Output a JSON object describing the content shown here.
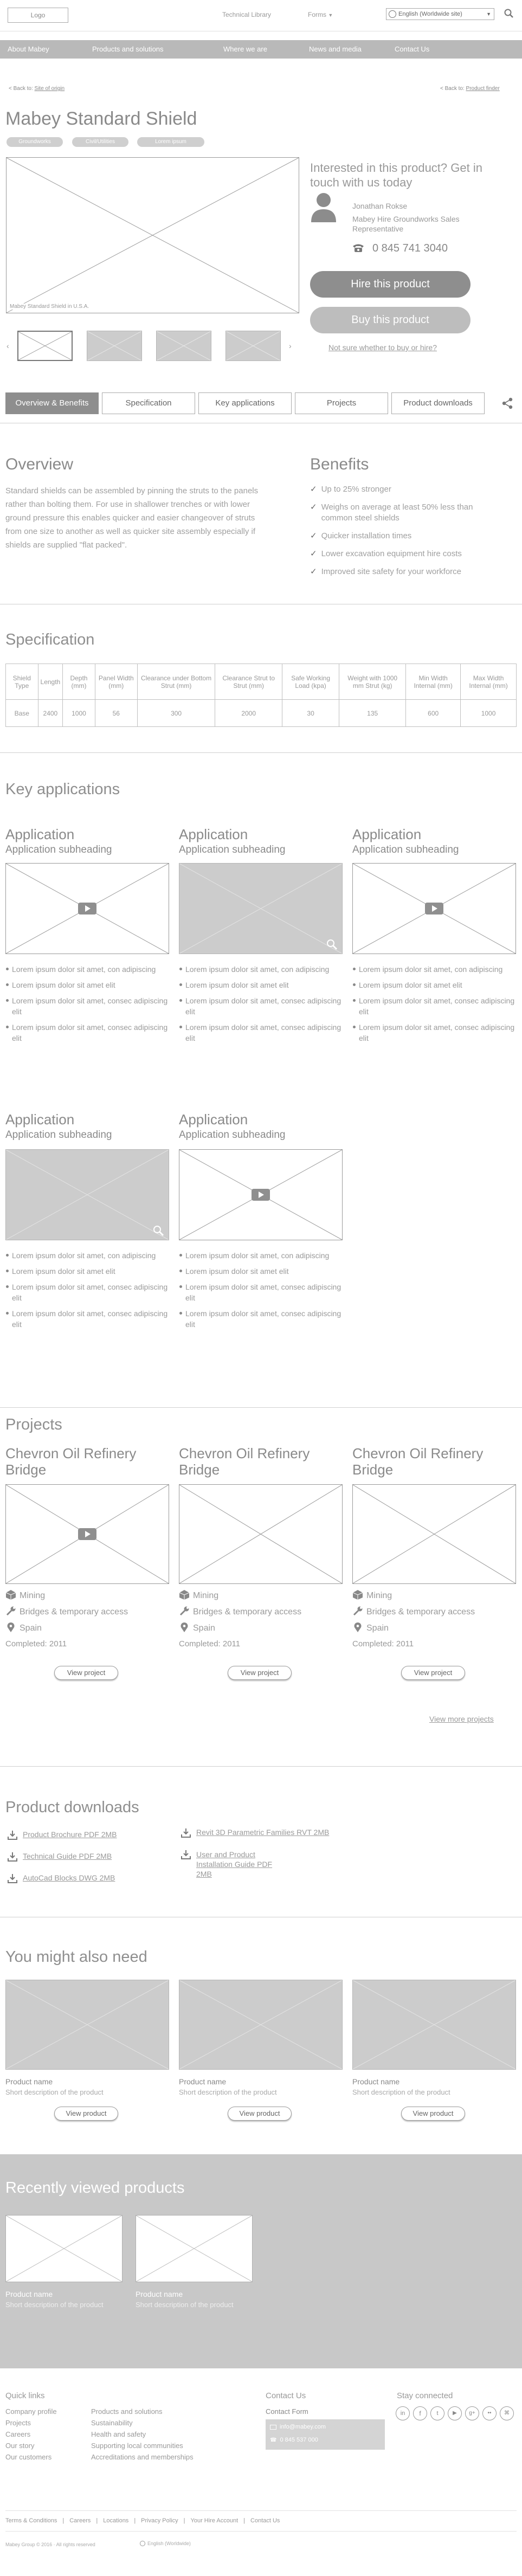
{
  "header": {
    "logo": "Logo",
    "links": [
      "Technical Library",
      "Forms"
    ],
    "language": "English (Worldwide site)",
    "nav": [
      "About Mabey",
      "Products and solutions",
      "Where we are",
      "News and media",
      "Contact Us"
    ]
  },
  "breadcrumbs": {
    "back": "< Back to:",
    "back_link": "Site of origin",
    "back_right": "< Back to:",
    "back_right_link": "Product finder"
  },
  "product": {
    "title": "Mabey Standard Shield",
    "tags": [
      "Groundworks",
      "Civil/Utilities",
      "Lorem ipsum"
    ],
    "image_caption": "Mabey Standard Shield in U.S.A."
  },
  "contact_box": {
    "heading": "Interested in this product? Get in touch with us today",
    "name": "Jonathan Rokse",
    "role": "Mabey Hire Groundworks Sales Representative",
    "phone": "0 845 741 3040",
    "hire_button": "Hire this product",
    "buy_button": "Buy this product",
    "unsure_link": "Not sure whether to buy or hire?"
  },
  "tabs": [
    "Overview & Benefits",
    "Specification",
    "Key applications",
    "Projects",
    "Product downloads"
  ],
  "overview": {
    "heading": "Overview",
    "text": "Standard shields can be assembled by pinning the struts to the panels rather than bolting them. For use in shallower trenches or with lower ground pressure this enables quicker and easier changeover of struts from one size to another as well as quicker site assembly especially if shields are supplied \"flat packed\"."
  },
  "benefits": {
    "heading": "Benefits",
    "items": [
      "Up to 25% stronger",
      "Weighs on average at least 50% less than common steel shields",
      "Quicker installation times",
      "Lower excavation equipment hire costs",
      "Improved site safety for your workforce"
    ]
  },
  "specification": {
    "heading": "Specification",
    "headers": [
      "Shield Type",
      "Length",
      "Depth (mm)",
      "Panel Width (mm)",
      "Clearance under Bottom Strut (mm)",
      "Clearance Strut to Strut (mm)",
      "Safe Working Load (kpa)",
      "Weight with 1000 mm Strut (kg)",
      "Min Width Internal (mm)",
      "Max Width Internal (mm)"
    ],
    "row": [
      "Base",
      "2400",
      "1000",
      "56",
      "300",
      "2000",
      "30",
      "135",
      "600",
      "1000"
    ]
  },
  "key_applications": {
    "heading": "Key applications",
    "items": [
      {
        "title": "Application",
        "subheading": "Application subheading",
        "bullets": [
          "Lorem ipsum dolor sit amet, con adipiscing",
          "Lorem ipsum dolor sit amet elit",
          "Lorem ipsum dolor sit amet, consec adipiscing elit",
          "Lorem ipsum dolor sit amet, consec adipiscing elit"
        ]
      },
      {
        "title": "Application",
        "subheading": "Application subheading",
        "bullets": [
          "Lorem ipsum dolor sit amet, con adipiscing",
          "Lorem ipsum dolor sit amet elit",
          "Lorem ipsum dolor sit amet, consec adipiscing elit",
          "Lorem ipsum dolor sit amet, consec adipiscing elit"
        ]
      },
      {
        "title": "Application",
        "subheading": "Application subheading",
        "bullets": [
          "Lorem ipsum dolor sit amet, con adipiscing",
          "Lorem ipsum dolor sit amet elit",
          "Lorem ipsum dolor sit amet, consec adipiscing elit",
          "Lorem ipsum dolor sit amet, consec adipiscing elit"
        ]
      },
      {
        "title": "Application",
        "subheading": "Application subheading",
        "bullets": [
          "Lorem ipsum dolor sit amet, con adipiscing",
          "Lorem ipsum dolor sit amet elit",
          "Lorem ipsum dolor sit amet, consec adipiscing elit",
          "Lorem ipsum dolor sit amet, consec adipiscing elit"
        ]
      },
      {
        "title": "Application",
        "subheading": "Application subheading",
        "bullets": [
          "Lorem ipsum dolor sit amet, con adipiscing",
          "Lorem ipsum dolor sit amet elit",
          "Lorem ipsum dolor sit amet, consec adipiscing elit",
          "Lorem ipsum dolor sit amet, consec adipiscing elit"
        ]
      }
    ]
  },
  "projects": {
    "heading": "Projects",
    "items": [
      {
        "title": "Chevron Oil Refinery Bridge",
        "sector": "Mining",
        "type": "Bridges & temporary access",
        "country": "Spain",
        "completed": "Completed: 2011",
        "button": "View project"
      },
      {
        "title": "Chevron Oil Refinery Bridge",
        "sector": "Mining",
        "type": "Bridges & temporary access",
        "country": "Spain",
        "completed": "Completed: 2011",
        "button": "View project"
      },
      {
        "title": "Chevron Oil Refinery Bridge",
        "sector": "Mining",
        "type": "Bridges & temporary access",
        "country": "Spain",
        "completed": "Completed: 2011",
        "button": "View project"
      }
    ],
    "more_link": "View more projects"
  },
  "downloads": {
    "heading": "Product downloads",
    "left": [
      "Product Brochure PDF 2MB",
      "Technical Guide PDF 2MB",
      "AutoCad Blocks DWG 2MB"
    ],
    "right": [
      "Revit 3D Parametric Families RVT 2MB",
      "User and Product Installation Guide PDF 2MB"
    ]
  },
  "also_need": {
    "heading": "You might also need",
    "items": [
      {
        "name": "Product name",
        "desc": "Short description of the product",
        "button": "View product"
      },
      {
        "name": "Product name",
        "desc": "Short description of the product",
        "button": "View product"
      },
      {
        "name": "Product name",
        "desc": "Short description of the product",
        "button": "View product"
      }
    ]
  },
  "recently_viewed": {
    "heading": "Recently viewed products",
    "items": [
      {
        "name": "Product name",
        "desc": "Short description of the product"
      },
      {
        "name": "Product name",
        "desc": "Short description of the product"
      }
    ]
  },
  "footer": {
    "quick_links_heading": "Quick links",
    "col1": [
      "Company profile",
      "Projects",
      "Careers",
      "Our story",
      "Our customers"
    ],
    "col2": [
      "Products and solutions",
      "Sustainability",
      "Health and safety",
      "Supporting local communities",
      "Accreditations and memberships"
    ],
    "contact_heading": "Contact Us",
    "contact_form": "Contact Form",
    "email": "info@mabey.com",
    "phone": "0 845 537 000",
    "stay_connected": "Stay connected",
    "bottom_links": [
      "Terms & Conditions",
      "Careers",
      "Locations",
      "Privacy Policy",
      "Your Hire Account",
      "Contact Us"
    ],
    "copyright": "Mabey Group © 2016 · All rights reserved",
    "language": "English (Worldwide)"
  },
  "colors": {
    "nav_bar": "#b9b9b9",
    "hire_button": "#8e8e8e",
    "buy_button": "#bdbdbd",
    "recent_band": "#c8c8c8",
    "footer_bg": "#d4d4d4"
  }
}
